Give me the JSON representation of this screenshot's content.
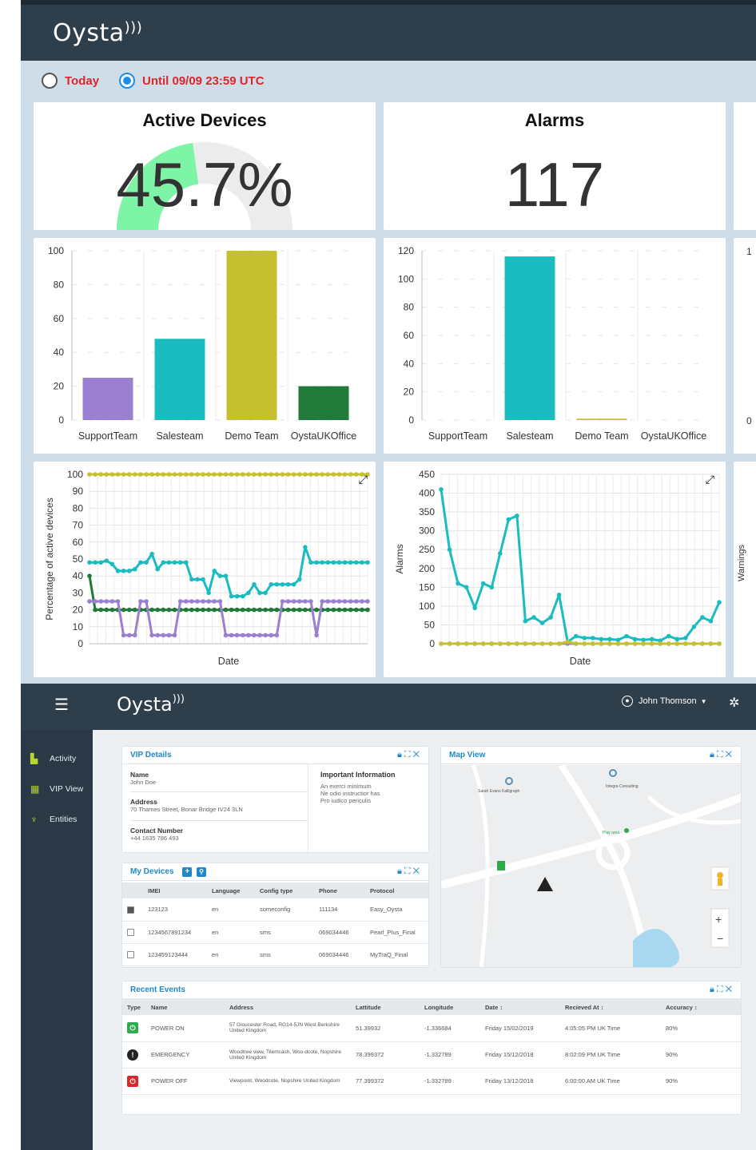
{
  "top": {
    "logo": "Oysta",
    "radio_today": "Today",
    "radio_until": "Until 09/09 23:59 UTC",
    "cards": {
      "active_title": "Active Devices",
      "active_value": "45.7%",
      "active_fraction": 0.457,
      "alarms_title": "Alarms",
      "alarms_value": "117"
    },
    "third_column_fragments": {
      "bar_ytick_top": "1",
      "bar_ytick_zero": "0",
      "line_ylabel": "Warnings"
    }
  },
  "colors": {
    "purple": "#9b7fd0",
    "teal": "#1bbcc0",
    "olive": "#c5c02e",
    "green": "#217a3a",
    "gauge": "#7ef4a7",
    "header": "#2f3e4b",
    "accent_blue": "#1e88c8"
  },
  "chart_data": [
    {
      "type": "bar",
      "categories": [
        "SupportTeam",
        "Salesteam",
        "Demo Team",
        "OystaUKOffice"
      ],
      "values": [
        25,
        48,
        100,
        20
      ],
      "ylim": [
        0,
        100
      ],
      "yticks": [
        0,
        20,
        40,
        60,
        80,
        100
      ],
      "grid": true,
      "colors": [
        "#9b7fd0",
        "#1bbcc0",
        "#c5c02e",
        "#217a3a"
      ]
    },
    {
      "type": "bar",
      "categories": [
        "SupportTeam",
        "Salesteam",
        "Demo Team",
        "OystaUKOffice"
      ],
      "values": [
        0,
        116,
        1,
        0
      ],
      "ylim": [
        0,
        120
      ],
      "yticks": [
        0,
        20,
        40,
        60,
        80,
        100,
        120
      ],
      "grid": true,
      "colors": [
        "#9b7fd0",
        "#1bbcc0",
        "#c5c02e",
        "#217a3a"
      ]
    },
    {
      "type": "line",
      "xlabel": "Date",
      "ylabel": "Percentage of active devices",
      "ylim": [
        0,
        100
      ],
      "yticks": [
        0,
        10,
        20,
        30,
        40,
        50,
        60,
        70,
        80,
        90,
        100
      ],
      "grid": true,
      "series": [
        {
          "color": "#c5c02e",
          "values": [
            100,
            100,
            100,
            100,
            100,
            100,
            100,
            100,
            100,
            100,
            100,
            100,
            100,
            100,
            100,
            100,
            100,
            100,
            100,
            100,
            100,
            100,
            100,
            100,
            100,
            100,
            100,
            100,
            100,
            100,
            100,
            100,
            100,
            100,
            100,
            100,
            100,
            100,
            100,
            100,
            100,
            100,
            100,
            100,
            100,
            100,
            100,
            100,
            100,
            100
          ]
        },
        {
          "color": "#1bbcc0",
          "values": [
            48,
            48,
            48,
            49,
            47,
            43,
            43,
            43,
            44,
            48,
            48,
            53,
            44,
            48,
            48,
            48,
            48,
            48,
            38,
            38,
            38,
            30,
            43,
            40,
            40,
            28,
            28,
            28,
            30,
            35,
            30,
            30,
            35,
            35,
            35,
            35,
            35,
            38,
            57,
            48,
            48,
            48,
            48,
            48,
            48,
            48,
            48,
            48,
            48,
            48
          ]
        },
        {
          "color": "#217a3a",
          "values": [
            40,
            20,
            20,
            20,
            20,
            20,
            20,
            20,
            20,
            20,
            20,
            20,
            20,
            20,
            20,
            20,
            20,
            20,
            20,
            20,
            20,
            20,
            20,
            20,
            20,
            20,
            20,
            20,
            20,
            20,
            20,
            20,
            20,
            20,
            20,
            20,
            20,
            20,
            20,
            20,
            20,
            20,
            20,
            20,
            20,
            20,
            20,
            20,
            20,
            20
          ]
        },
        {
          "color": "#9b7fd0",
          "values": [
            25,
            25,
            25,
            25,
            25,
            25,
            5,
            5,
            5,
            25,
            25,
            5,
            5,
            5,
            5,
            5,
            25,
            25,
            25,
            25,
            25,
            25,
            25,
            25,
            5,
            5,
            5,
            5,
            5,
            5,
            5,
            5,
            5,
            5,
            25,
            25,
            25,
            25,
            25,
            25,
            5,
            25,
            25,
            25,
            25,
            25,
            25,
            25,
            25,
            25
          ]
        }
      ]
    },
    {
      "type": "line",
      "xlabel": "Date",
      "ylabel": "Alarms",
      "ylim": [
        0,
        450
      ],
      "yticks": [
        0,
        50,
        100,
        150,
        200,
        250,
        300,
        350,
        400,
        450
      ],
      "grid": true,
      "series": [
        {
          "color": "#1bbcc0",
          "values": [
            410,
            250,
            160,
            150,
            95,
            160,
            150,
            240,
            330,
            340,
            60,
            70,
            55,
            70,
            130,
            5,
            20,
            15,
            15,
            12,
            12,
            10,
            20,
            12,
            10,
            12,
            8,
            20,
            12,
            15,
            45,
            70,
            60,
            110
          ]
        },
        {
          "color": "#9b7fd0",
          "values": [
            0,
            0,
            0,
            0,
            0,
            0,
            0,
            0,
            0,
            0,
            0,
            0,
            0,
            0,
            0,
            0,
            0,
            0,
            0,
            0,
            0,
            0,
            0,
            0,
            0,
            0,
            0,
            0,
            0,
            0,
            0,
            0,
            0,
            0
          ]
        },
        {
          "color": "#c5c02e",
          "values": [
            0,
            0,
            0,
            0,
            0,
            0,
            0,
            0,
            0,
            0,
            0,
            0,
            0,
            0,
            0,
            5,
            0,
            0,
            0,
            0,
            0,
            0,
            0,
            0,
            0,
            0,
            0,
            0,
            0,
            0,
            0,
            0,
            0,
            0
          ]
        }
      ]
    }
  ],
  "app": {
    "logo": "Oysta",
    "user_name": "John Thomson",
    "sidebar": [
      {
        "label": "Activity",
        "icon": "bar-chart-icon"
      },
      {
        "label": "VIP View",
        "icon": "grid-icon"
      },
      {
        "label": "Entities",
        "icon": "hierarchy-icon"
      }
    ],
    "vip": {
      "title": "VIP Details",
      "name_label": "Name",
      "name_value": "John Doe",
      "address_label": "Address",
      "address_value": "70 Thames Street, Bonar Bridge IV24 3LN",
      "contact_label": "Contact Number",
      "contact_value": "+44 1635 786 493",
      "important_label": "Important Information",
      "important_lines": [
        "An exerci minimum",
        "Ne odio instructior has",
        "Pro iudico periculis"
      ]
    },
    "devices": {
      "title": "My Devices",
      "columns": [
        "IMEI",
        "Language",
        "Config type",
        "Phone",
        "Protocol"
      ],
      "rows": [
        {
          "checked": true,
          "cells": [
            "123123",
            "en",
            "someconfig",
            "111134",
            "Easy_Oysta"
          ]
        },
        {
          "checked": false,
          "cells": [
            "1234567891234",
            "en",
            "sms",
            "069034446",
            "Pearl_Plus_Final"
          ]
        },
        {
          "checked": false,
          "cells": [
            "123459123444",
            "en",
            "sms",
            "069034446",
            "MyTraQ_Final"
          ]
        }
      ]
    },
    "map": {
      "title": "Map View",
      "places": [
        "Integra Consulting",
        "Sarah Evans Kalligraph",
        "Play area"
      ]
    },
    "events": {
      "title": "Recent Events",
      "columns": [
        "Type",
        "Name",
        "Address",
        "Lattitude",
        "Longitude",
        "Date ↕",
        "Recieved At ↕",
        "Accuracy ↕"
      ],
      "rows": [
        {
          "icon": "power-on-icon",
          "color": "#2eaa4a",
          "name": "POWER ON",
          "address": "57 Gloucester Road, RG14-5JN West Berkshire United Kingdom",
          "lat": "51.39932",
          "lon": "-1.336684",
          "date": "Friday 15/02/2019",
          "received": "4:05:05 PM UK Time",
          "accuracy": "80%"
        },
        {
          "icon": "warning-icon",
          "color": "#222222",
          "name": "EMERGENCY",
          "address": "Woodtree view, Tilemcash, Woo-dcote, Nopshire United Kingdom",
          "lat": "78.399372",
          "lon": "-1.332789",
          "date": "Friday 15/12/2018",
          "received": "8:02:09 PM UK Time",
          "accuracy": "90%"
        },
        {
          "icon": "power-off-icon",
          "color": "#d9262b",
          "name": "POWER OFF",
          "address": "Viewpoint, Woodcote, Nopshire United Kingdom",
          "lat": "77.399372",
          "lon": "-1.332789",
          "date": "Friday 13/12/2018",
          "received": "6:00:00 AM UK Time",
          "accuracy": "90%"
        }
      ]
    }
  }
}
